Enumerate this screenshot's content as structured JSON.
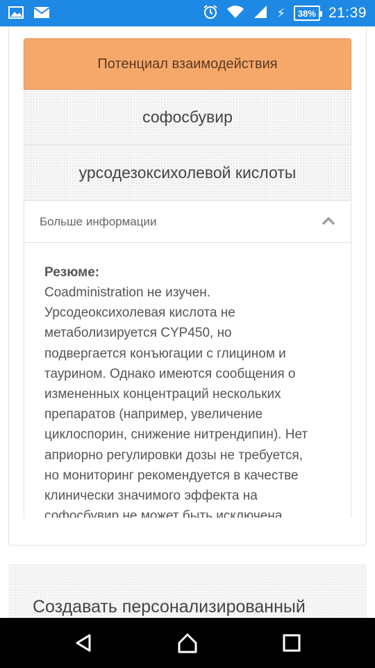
{
  "status_bar": {
    "time": "21:39",
    "battery": "38%",
    "icons": [
      "image-icon",
      "mail-icon",
      "alarm-icon",
      "wifi-icon",
      "signal-icon",
      "charging-icon",
      "battery-icon"
    ]
  },
  "interaction": {
    "header": "Потенциал взаимодействия",
    "header_color": "#f5a86a",
    "drug_1": "софосбувир",
    "drug_2": "урсодезоксихолевой кислоты",
    "more_info_label": "Больше информации",
    "summary_label": "Резюме:",
    "summary_lines": [
      "Coadministration не изучен.",
      "Урсодеоксихолевая кислота не",
      "метаболизируется CYP450, но",
      "подвергается конъюгации с глицином и",
      "таурином. Однако имеются сообщения о",
      "измененных концентраций нескольких",
      "препаратов (например, увеличение",
      "циклоспорин, снижение нитрендипин). Нет",
      "априорно регулировки дозы не требуется,",
      "но мониторинг рекомендуется в качестве",
      "клинически значимого эффекта на",
      "софосбувир не может быть исключена."
    ]
  },
  "personalized": {
    "text": "Создавать персонализированный"
  },
  "nav_bar": {
    "icons": [
      "back-icon",
      "home-icon",
      "recent-apps-icon"
    ]
  }
}
